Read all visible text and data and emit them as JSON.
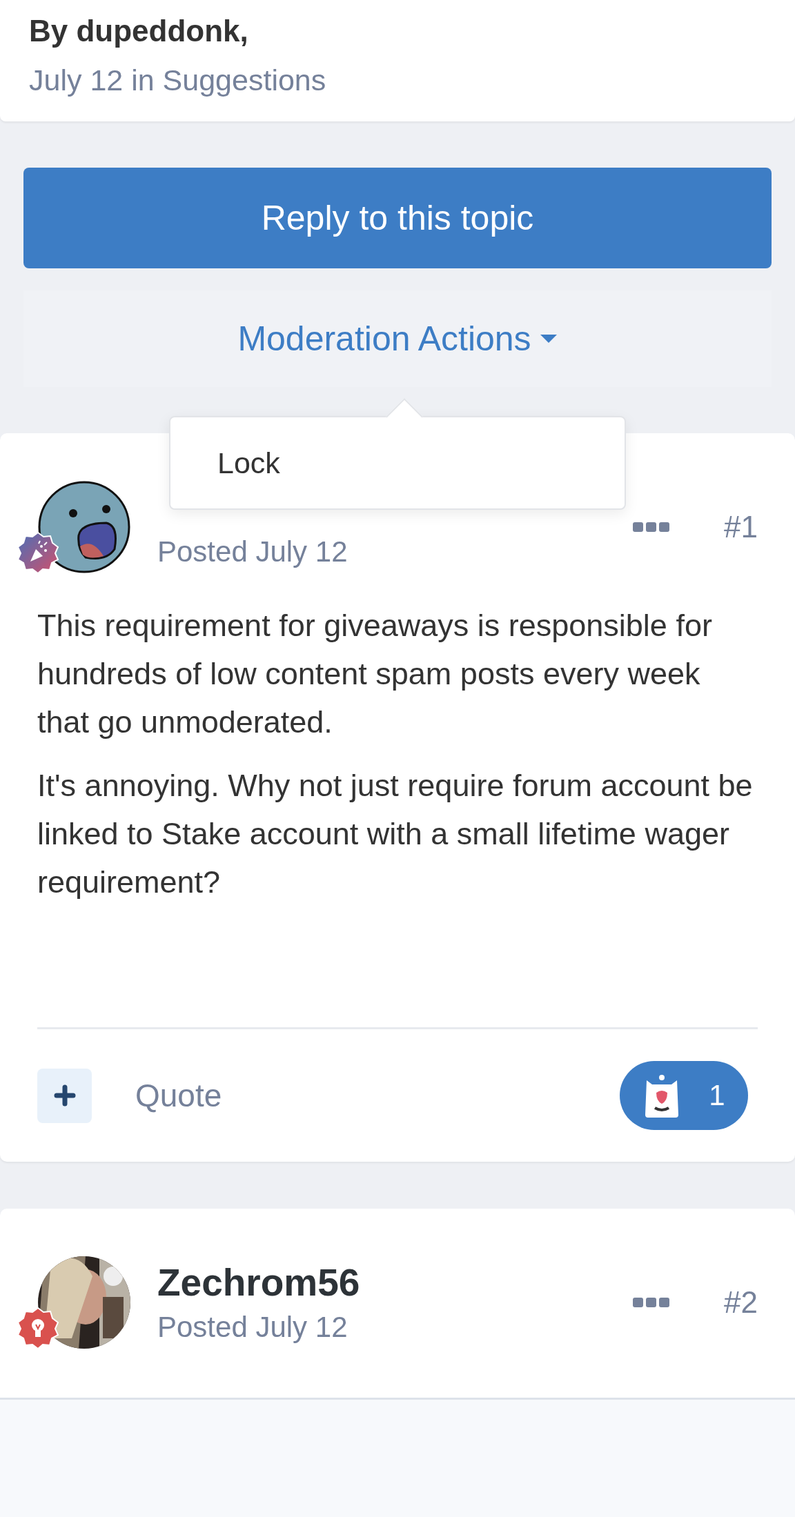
{
  "topic_header": {
    "author": "By dupeddonk,",
    "meta": "July 12 in Suggestions"
  },
  "reply_button": "Reply to this topic",
  "moderation": {
    "label": "Moderation Actions",
    "expanded": true,
    "menu_items": [
      "Lock"
    ]
  },
  "posts": [
    {
      "avatar": {
        "kind": "cartoon"
      },
      "badge": {
        "kind": "party"
      },
      "posted": "Posted July 12",
      "number": "#1",
      "body": [
        "This requirement for giveaways is responsible for hundreds of low content spam posts every week that go unmoderated.",
        "It's annoying.  Why not just require forum account be linked to Stake account with a small lifetime wager requirement?"
      ],
      "footer": {
        "quote": "Quote",
        "reaction_count": "1"
      }
    },
    {
      "badge": {
        "kind": "bulb"
      },
      "author": "Zechrom56",
      "posted": "Posted July 12",
      "number": "#2"
    }
  ]
}
